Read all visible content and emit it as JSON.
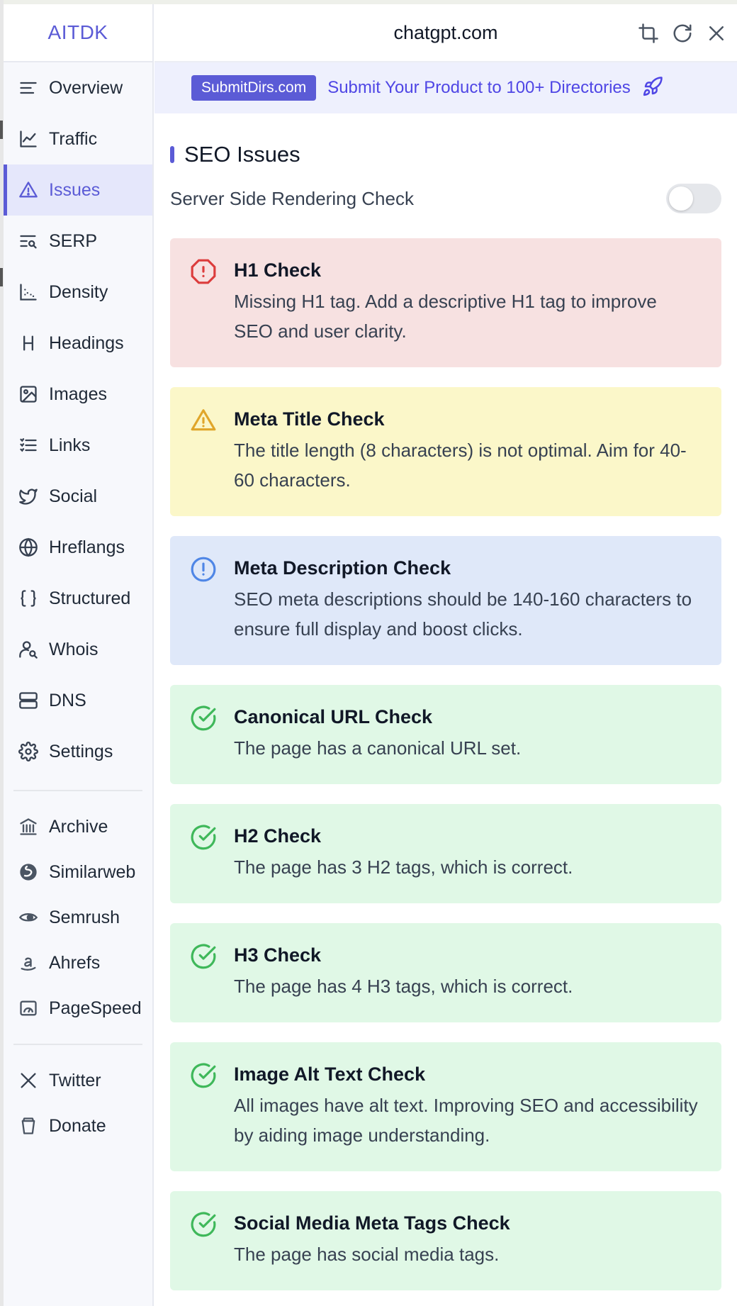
{
  "brand": "AITDK",
  "domain": "chatgpt.com",
  "promo": {
    "badge": "SubmitDirs.com",
    "text": "Submit Your Product to 100+ Directories"
  },
  "nav": [
    {
      "label": "Overview",
      "icon": "overview-icon"
    },
    {
      "label": "Traffic",
      "icon": "traffic-chart-icon"
    },
    {
      "label": "Issues",
      "icon": "warning-triangle-icon",
      "active": true
    },
    {
      "label": "SERP",
      "icon": "serp-search-icon"
    },
    {
      "label": "Density",
      "icon": "scatter-chart-icon"
    },
    {
      "label": "Headings",
      "icon": "heading-icon"
    },
    {
      "label": "Images",
      "icon": "image-icon"
    },
    {
      "label": "Links",
      "icon": "list-icon"
    },
    {
      "label": "Social",
      "icon": "twitter-bird-icon"
    },
    {
      "label": "Hreflangs",
      "icon": "globe-icon"
    },
    {
      "label": "Structured",
      "icon": "braces-icon"
    },
    {
      "label": "Whois",
      "icon": "user-search-icon"
    },
    {
      "label": "DNS",
      "icon": "server-icon"
    },
    {
      "label": "Settings",
      "icon": "gear-icon"
    }
  ],
  "external": [
    {
      "label": "Archive",
      "icon": "archive-icon"
    },
    {
      "label": "Similarweb",
      "icon": "similarweb-icon"
    },
    {
      "label": "Semrush",
      "icon": "semrush-icon"
    },
    {
      "label": "Ahrefs",
      "icon": "amazon-a-icon"
    },
    {
      "label": "PageSpeed",
      "icon": "pagespeed-icon"
    }
  ],
  "social": [
    {
      "label": "Twitter",
      "icon": "x-logo-icon"
    },
    {
      "label": "Donate",
      "icon": "cup-icon"
    }
  ],
  "section": {
    "title": "SEO Issues",
    "ssr_label": "Server Side Rendering Check",
    "ssr_enabled": false
  },
  "checks": [
    {
      "title": "H1 Check",
      "desc": "Missing H1 tag. Add a descriptive H1 tag to improve SEO and user clarity.",
      "status": "error",
      "color": "#dc3c3c"
    },
    {
      "title": "Meta Title Check",
      "desc": "The title length (8 characters) is not optimal. Aim for 40-60 characters.",
      "status": "warning",
      "color": "#e0a62a"
    },
    {
      "title": "Meta Description Check",
      "desc": "SEO meta descriptions should be 140-160 characters to ensure full display and boost clicks.",
      "status": "info",
      "color": "#4f86e6"
    },
    {
      "title": "Canonical URL Check",
      "desc": "The page has a canonical URL set.",
      "status": "success",
      "color": "#3fb85a"
    },
    {
      "title": "H2 Check",
      "desc": "The page has 3 H2 tags, which is correct.",
      "status": "success",
      "color": "#3fb85a"
    },
    {
      "title": "H3 Check",
      "desc": "The page has 4 H3 tags, which is correct.",
      "status": "success",
      "color": "#3fb85a"
    },
    {
      "title": "Image Alt Text Check",
      "desc": "All images have alt text. Improving SEO and accessibility by aiding image understanding.",
      "status": "success",
      "color": "#3fb85a"
    },
    {
      "title": "Social Media Meta Tags Check",
      "desc": "The page has social media tags.",
      "status": "success",
      "color": "#3fb85a"
    }
  ]
}
